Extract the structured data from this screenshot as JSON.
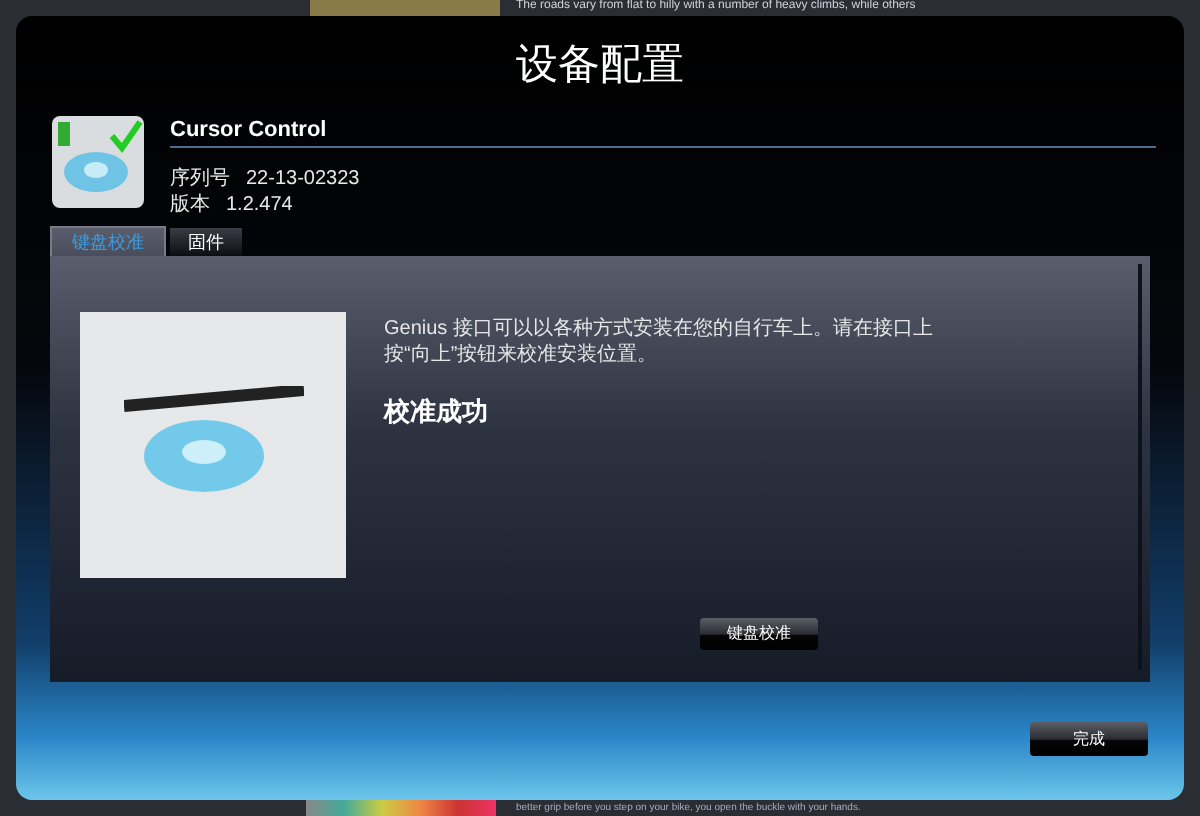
{
  "background_page": {
    "top_caption": "The roads vary from flat to hilly with a number of heavy climbs, while others",
    "bottom_caption": "better grip before you step on your bike, you open the buckle with your hands."
  },
  "window": {
    "title": "设备配置"
  },
  "device": {
    "name": "Cursor Control",
    "serial_label": "序列号",
    "serial": "22-13-02323",
    "version_label": "版本",
    "version": "1.2.474"
  },
  "tabs": [
    {
      "label": "键盘校准",
      "selected": true
    },
    {
      "label": "固件",
      "selected": false
    }
  ],
  "panel": {
    "description": "Genius 接口可以以各种方式安装在您的自行车上。请在接口上按“向上”按钮来校准安装位置。",
    "status": "校准成功",
    "button": "键盘校准"
  },
  "buttons": [
    "完成"
  ]
}
